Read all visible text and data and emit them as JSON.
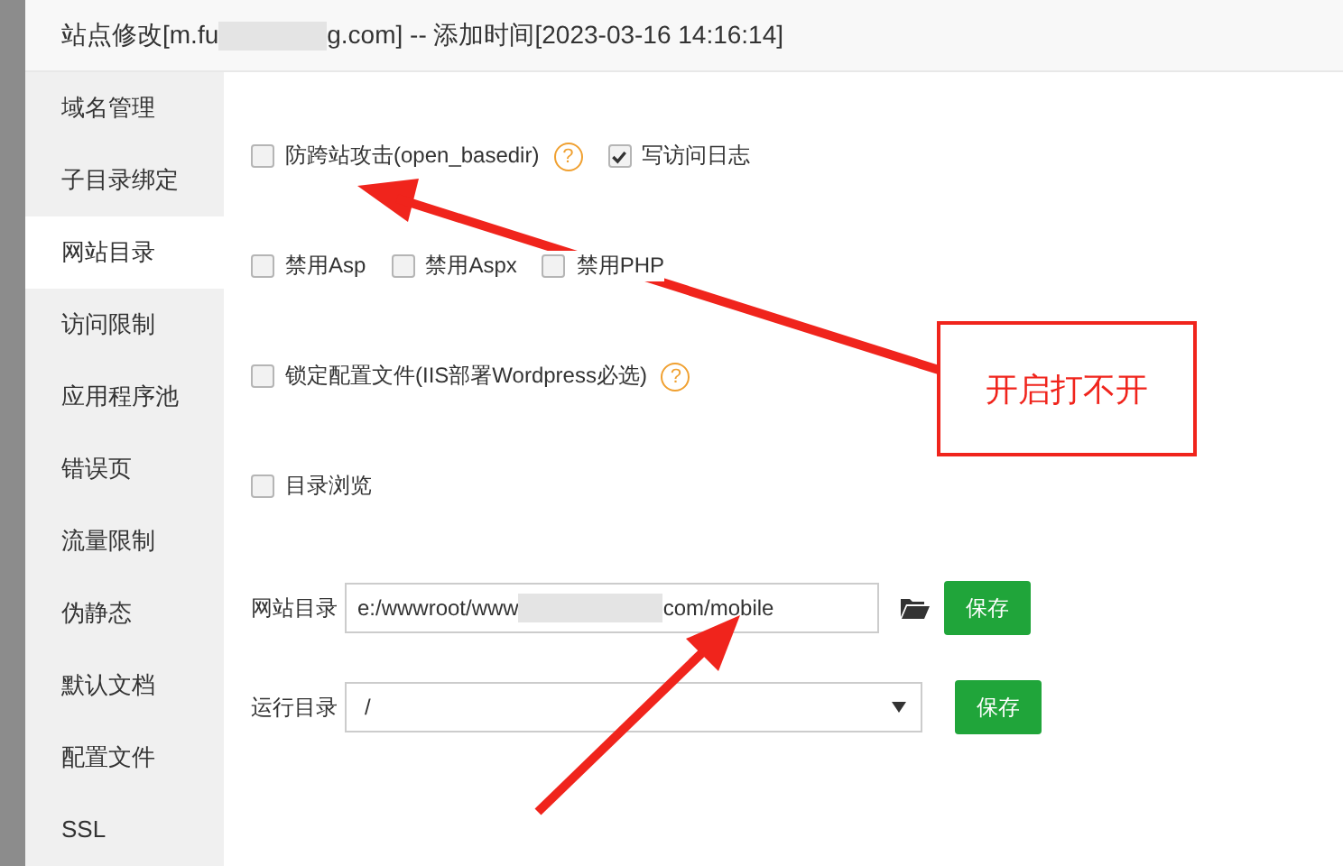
{
  "dialog": {
    "title_start": "站点修改[m.fu",
    "title_end": "g.com] -- 添加时间[2023-03-16 14:16:14]"
  },
  "sidebar": {
    "items": [
      {
        "label": "域名管理",
        "selected": false
      },
      {
        "label": "子目录绑定",
        "selected": false
      },
      {
        "label": "网站目录",
        "selected": true
      },
      {
        "label": "访问限制",
        "selected": false
      },
      {
        "label": "应用程序池",
        "selected": false
      },
      {
        "label": "错误页",
        "selected": false
      },
      {
        "label": "流量限制",
        "selected": false
      },
      {
        "label": "伪静态",
        "selected": false
      },
      {
        "label": "默认文档",
        "selected": false
      },
      {
        "label": "配置文件",
        "selected": false
      },
      {
        "label": "SSL",
        "selected": false
      }
    ]
  },
  "option_rows": [
    [
      {
        "label": "防跨站攻击(open_basedir)",
        "checked": false,
        "help": "?"
      },
      {
        "label": "写访问日志",
        "checked": true
      }
    ],
    [
      {
        "label": "禁用Asp",
        "checked": false
      },
      {
        "label": "禁用Aspx",
        "checked": false
      },
      {
        "label": "禁用PHP",
        "checked": false
      }
    ],
    [
      {
        "label": "锁定配置文件(IIS部署Wordpress必选)",
        "checked": false,
        "help": "?"
      }
    ],
    [
      {
        "label": "目录浏览",
        "checked": false
      }
    ]
  ],
  "path": {
    "label": "网站目录",
    "value_start": "e:/wwwroot/www",
    "value_end": "com/mobile",
    "button": "保存"
  },
  "run_dir": {
    "label": "运行目录",
    "value": "/",
    "button": "保存"
  },
  "annotation": {
    "note": "开启打不开"
  }
}
